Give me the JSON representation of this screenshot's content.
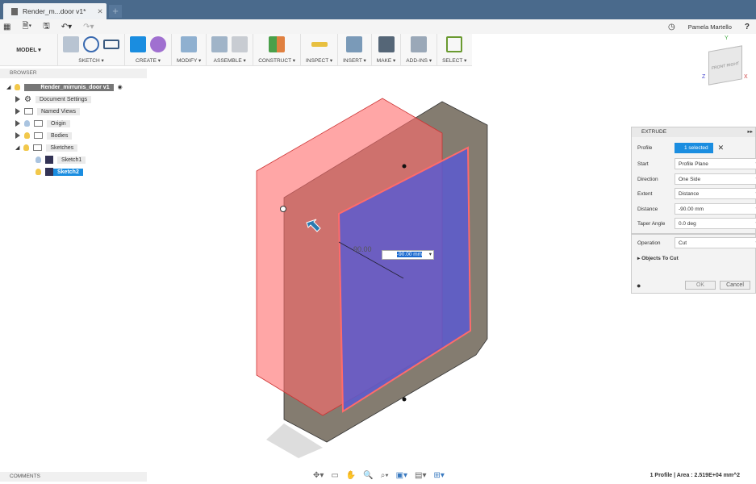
{
  "tab": {
    "title": "Render_m...door v1*",
    "close": "✕",
    "new": "+"
  },
  "quick": {
    "user": "Pamela Martello",
    "help": "?"
  },
  "ribbon": {
    "mode": "MODEL ▾",
    "groups": [
      "SKETCH ▾",
      "CREATE ▾",
      "MODIFY ▾",
      "ASSEMBLE ▾",
      "CONSTRUCT ▾",
      "INSPECT ▾",
      "INSERT ▾",
      "MAKE ▾",
      "ADD-INS ▾",
      "SELECT ▾"
    ]
  },
  "browser": {
    "title": "BROWSER",
    "root": "Render_mirrunis_door v1",
    "items": [
      "Document Settings",
      "Named Views",
      "Origin",
      "Bodies",
      "Sketches",
      "Sketch1",
      "Sketch2"
    ]
  },
  "viewport": {
    "dim_label": "90.00",
    "dim_input": "-90.00 mm",
    "colors": {
      "cut_body": "#ff6b6b",
      "profile": "#5a5ad0",
      "body": "#5b5040"
    }
  },
  "viewcube": {
    "front": "FRONT",
    "right": "RIGHT",
    "x": "X",
    "y": "Y",
    "z": "Z"
  },
  "extrude": {
    "title": "EXTRUDE",
    "profile_label": "Profile",
    "profile_value": "1 selected",
    "start_label": "Start",
    "start_value": "Profile Plane",
    "direction_label": "Direction",
    "direction_value": "One Side",
    "extent_label": "Extent",
    "extent_value": "Distance",
    "distance_label": "Distance",
    "distance_value": "-90.00 mm",
    "taper_label": "Taper Angle",
    "taper_value": "0.0 deg",
    "operation_label": "Operation",
    "operation_value": "Cut",
    "objects_to_cut": "Objects To Cut",
    "ok": "OK",
    "cancel": "Cancel"
  },
  "comments": "COMMENTS",
  "status": "1 Profile | Area : 2.519E+04 mm^2"
}
